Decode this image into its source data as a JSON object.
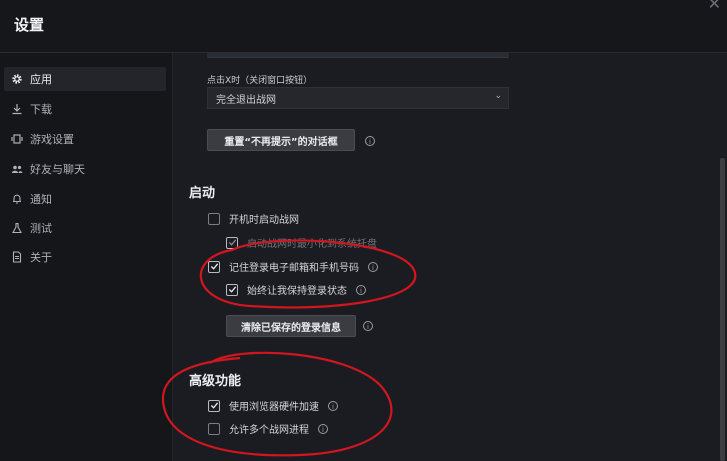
{
  "window": {
    "title": "设置"
  },
  "sidebar": {
    "items": [
      {
        "label": "应用",
        "icon": "gear-icon",
        "active": true
      },
      {
        "label": "下载",
        "icon": "download-icon",
        "active": false
      },
      {
        "label": "游戏设置",
        "icon": "gamepad-icon",
        "active": false
      },
      {
        "label": "好友与聊天",
        "icon": "users-icon",
        "active": false
      },
      {
        "label": "通知",
        "icon": "bell-icon",
        "active": false
      },
      {
        "label": "测试",
        "icon": "flask-icon",
        "active": false
      },
      {
        "label": "关于",
        "icon": "document-icon",
        "active": false
      }
    ]
  },
  "main": {
    "close_behavior": {
      "label": "点击X时（关闭窗口按钮）",
      "selected_value": "完全退出战网"
    },
    "reset_dialogs_button": "重置“不再提示”的对话框",
    "startup": {
      "title": "启动",
      "launch_on_startup": {
        "label": "开机时启动战网",
        "checked": false
      },
      "partially_hidden_row": {
        "label": "启动战网时最小化到系统托盘",
        "checked": true
      },
      "remember_login": {
        "label": "记住登录电子邮箱和手机号码",
        "checked": true
      },
      "stay_logged_in": {
        "label": "始终让我保持登录状态",
        "checked": true
      },
      "clear_login_button": "清除已保存的登录信息"
    },
    "advanced": {
      "title": "高级功能",
      "hardware_accel": {
        "label": "使用浏览器硬件加速",
        "checked": true
      },
      "multiple_instances": {
        "label": "允许多个战网进程",
        "checked": false
      }
    }
  },
  "colors": {
    "background": "#1b1c21",
    "sidebar": "#15161a",
    "annotation": "#d0171f"
  }
}
